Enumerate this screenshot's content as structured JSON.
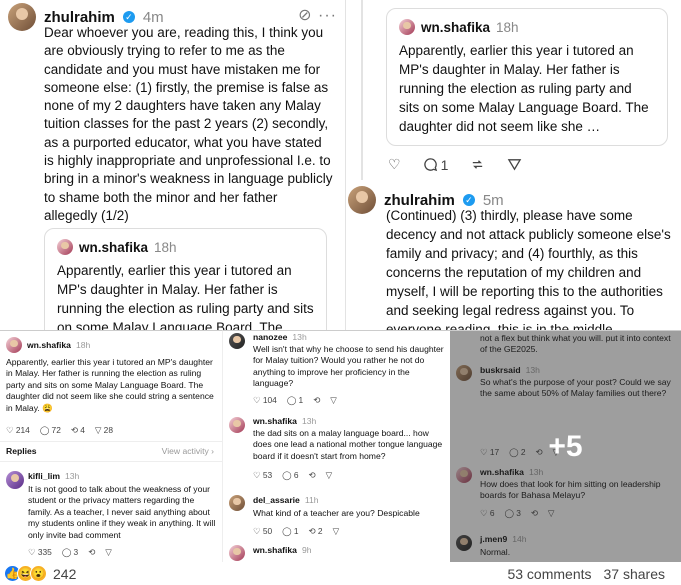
{
  "post_main": {
    "username": "zhulrahim",
    "time": "4m",
    "menu": "⊘ ···",
    "body": "Dear whoever you are, reading this,  I think you are obviously trying to refer to me as the candidate and you must have mistaken me for someone else: (1) firstly, the premise is false as none of my 2 daughters have taken any Malay tuition classes for the past 2 years (2) secondly, as a purported educator, what you have stated is highly inappropriate and unprofessional I.e. to bring in a minor's weakness in language publicly to shame both the minor and her father allegedly (1/2)",
    "quote": {
      "username": "wn.shafika",
      "time": "18h",
      "text": "Apparently, earlier this year i tutored an MP's daughter in Malay. Her father is running the election as ruling party and sits on some Malay Language Board. The"
    }
  },
  "post_right": {
    "quote": {
      "username": "wn.shafika",
      "time": "18h",
      "text": "Apparently, earlier this year i tutored an MP's daughter in Malay. Her father is running the election as ruling party and sits on some Malay Language Board. The daughter did not seem like she …"
    },
    "actions": {
      "like": "♡",
      "comment": "1",
      "repost": "⟲",
      "share": "▽"
    },
    "reply": {
      "username": "zhulrahim",
      "time": "5m",
      "text": "(Continued) (3) thirdly, please have some decency and not attack publicly someone else's family and privacy; and (4) fourthly, as this concerns the reputation of my children and myself, I will be reporting this to the authorities and seeking legal redress against you. To everyone reading, this is in the middle"
    }
  },
  "panel_b1": {
    "username": "wn.shafika",
    "time": "18h",
    "text": "Apparently, earlier this year i tutored an MP's daughter in Malay. Her father is running the election as ruling party and sits on some Malay Language Board. The daughter did not seem like she could string a sentence in Malay. 😩",
    "likes": "214",
    "comments": "72",
    "reposts": "4",
    "shares": "28",
    "replies_label": "Replies",
    "view_activity": "View activity ›",
    "reply": {
      "username": "kifli_lim",
      "time": "13h",
      "text": "It is not good to talk about the weakness of your student or the privacy matters regarding the family. As a teacher, I never said anything about my students online if they weak in anything. It will only invite bad comment",
      "likes": "335",
      "comments": "3"
    }
  },
  "panel_b2": {
    "items": [
      {
        "username": "nanozee",
        "time": "13h",
        "text": "Well isn't that why he choose to send his daughter for Malay tuition? Would you rather he not do anything to improve her proficiency in the language?",
        "likes": "104",
        "comments": "1"
      },
      {
        "username": "wn.shafika",
        "time": "13h",
        "text": "the dad sits on a malay language board... how does one lead a national mother tongue language board if it doesn't start from home?",
        "likes": "53",
        "comments": "6"
      },
      {
        "username": "del_assarie",
        "time": "11h",
        "text": "What kind of a teacher are you? Despicable",
        "likes": "50",
        "comments": "1",
        "reposts": "2"
      },
      {
        "username": "wn.shafika",
        "time": "9h",
        "text": ""
      }
    ]
  },
  "panel_b3": {
    "top_text": "not a flex but think what you will. put it into context of the GE2025.",
    "items": [
      {
        "username": "buskrsaid",
        "time": "13h",
        "text": "So what's the purpose of your post? Could we say the same about 50% of Malay families out there?",
        "likes": "17",
        "comments": "2"
      },
      {
        "username": "wn.shafika",
        "time": "13h",
        "text": "How does that look for him sitting on leadership boards for Bahasa Melayu?",
        "likes": "6",
        "comments": "3"
      },
      {
        "username": "j.men9",
        "time": "14h",
        "text": "Normal."
      }
    ],
    "more_label": "+5"
  },
  "footer": {
    "reaction_count": "242",
    "comments": "53 comments",
    "shares": "37 shares"
  }
}
